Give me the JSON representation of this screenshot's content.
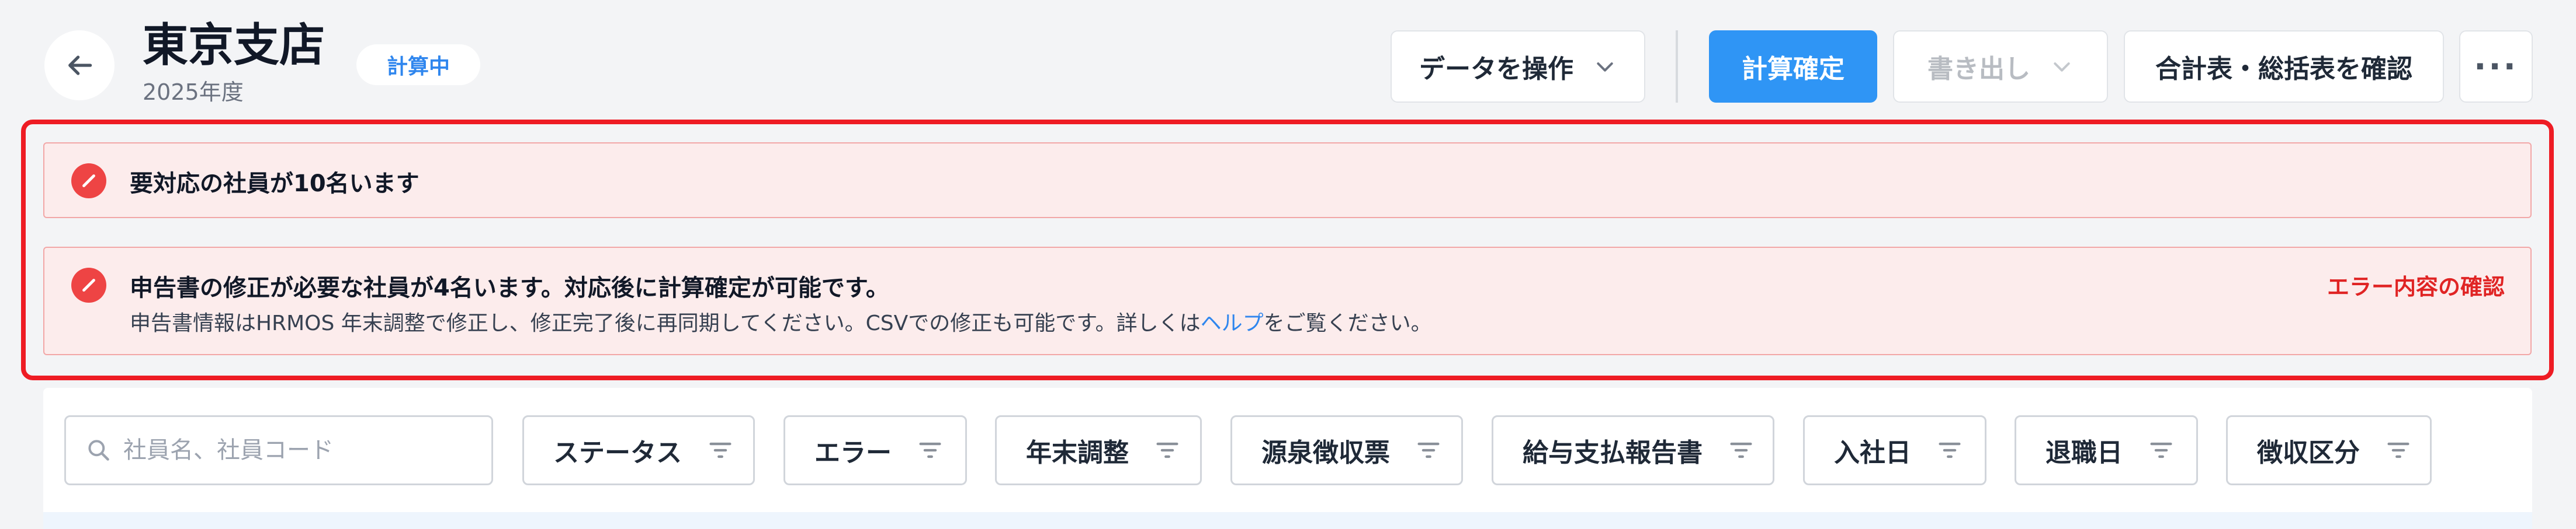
{
  "header": {
    "title": "東京支店",
    "subtitle": "2025年度",
    "status_badge": "計算中",
    "buttons": {
      "data_ops": "データを操作",
      "confirm": "計算確定",
      "export": "書き出し",
      "summary": "合計表・総括表を確認",
      "more": "···"
    }
  },
  "alerts": [
    {
      "title": "要対応の社員が10名います"
    },
    {
      "title": "申告書の修正が必要な社員が4名います。対応後に計算確定が可能です。",
      "desc_before": "申告書情報はHRMOS 年末調整で修正し、修正完了後に再同期してください。CSVでの修正も可能です。詳しくは",
      "desc_link": "ヘルプ",
      "desc_after": "をご覧ください。",
      "action": "エラー内容の確認"
    }
  ],
  "filters": {
    "search_placeholder": "社員名、社員コード",
    "items": [
      "ステータス",
      "エラー",
      "年末調整",
      "源泉徴収票",
      "給与支払報告書",
      "入社日",
      "退職日",
      "徴収区分"
    ]
  },
  "colors": {
    "accent": "#2f95f5",
    "error": "#ee1c24",
    "alert_bg": "#fcecec"
  }
}
